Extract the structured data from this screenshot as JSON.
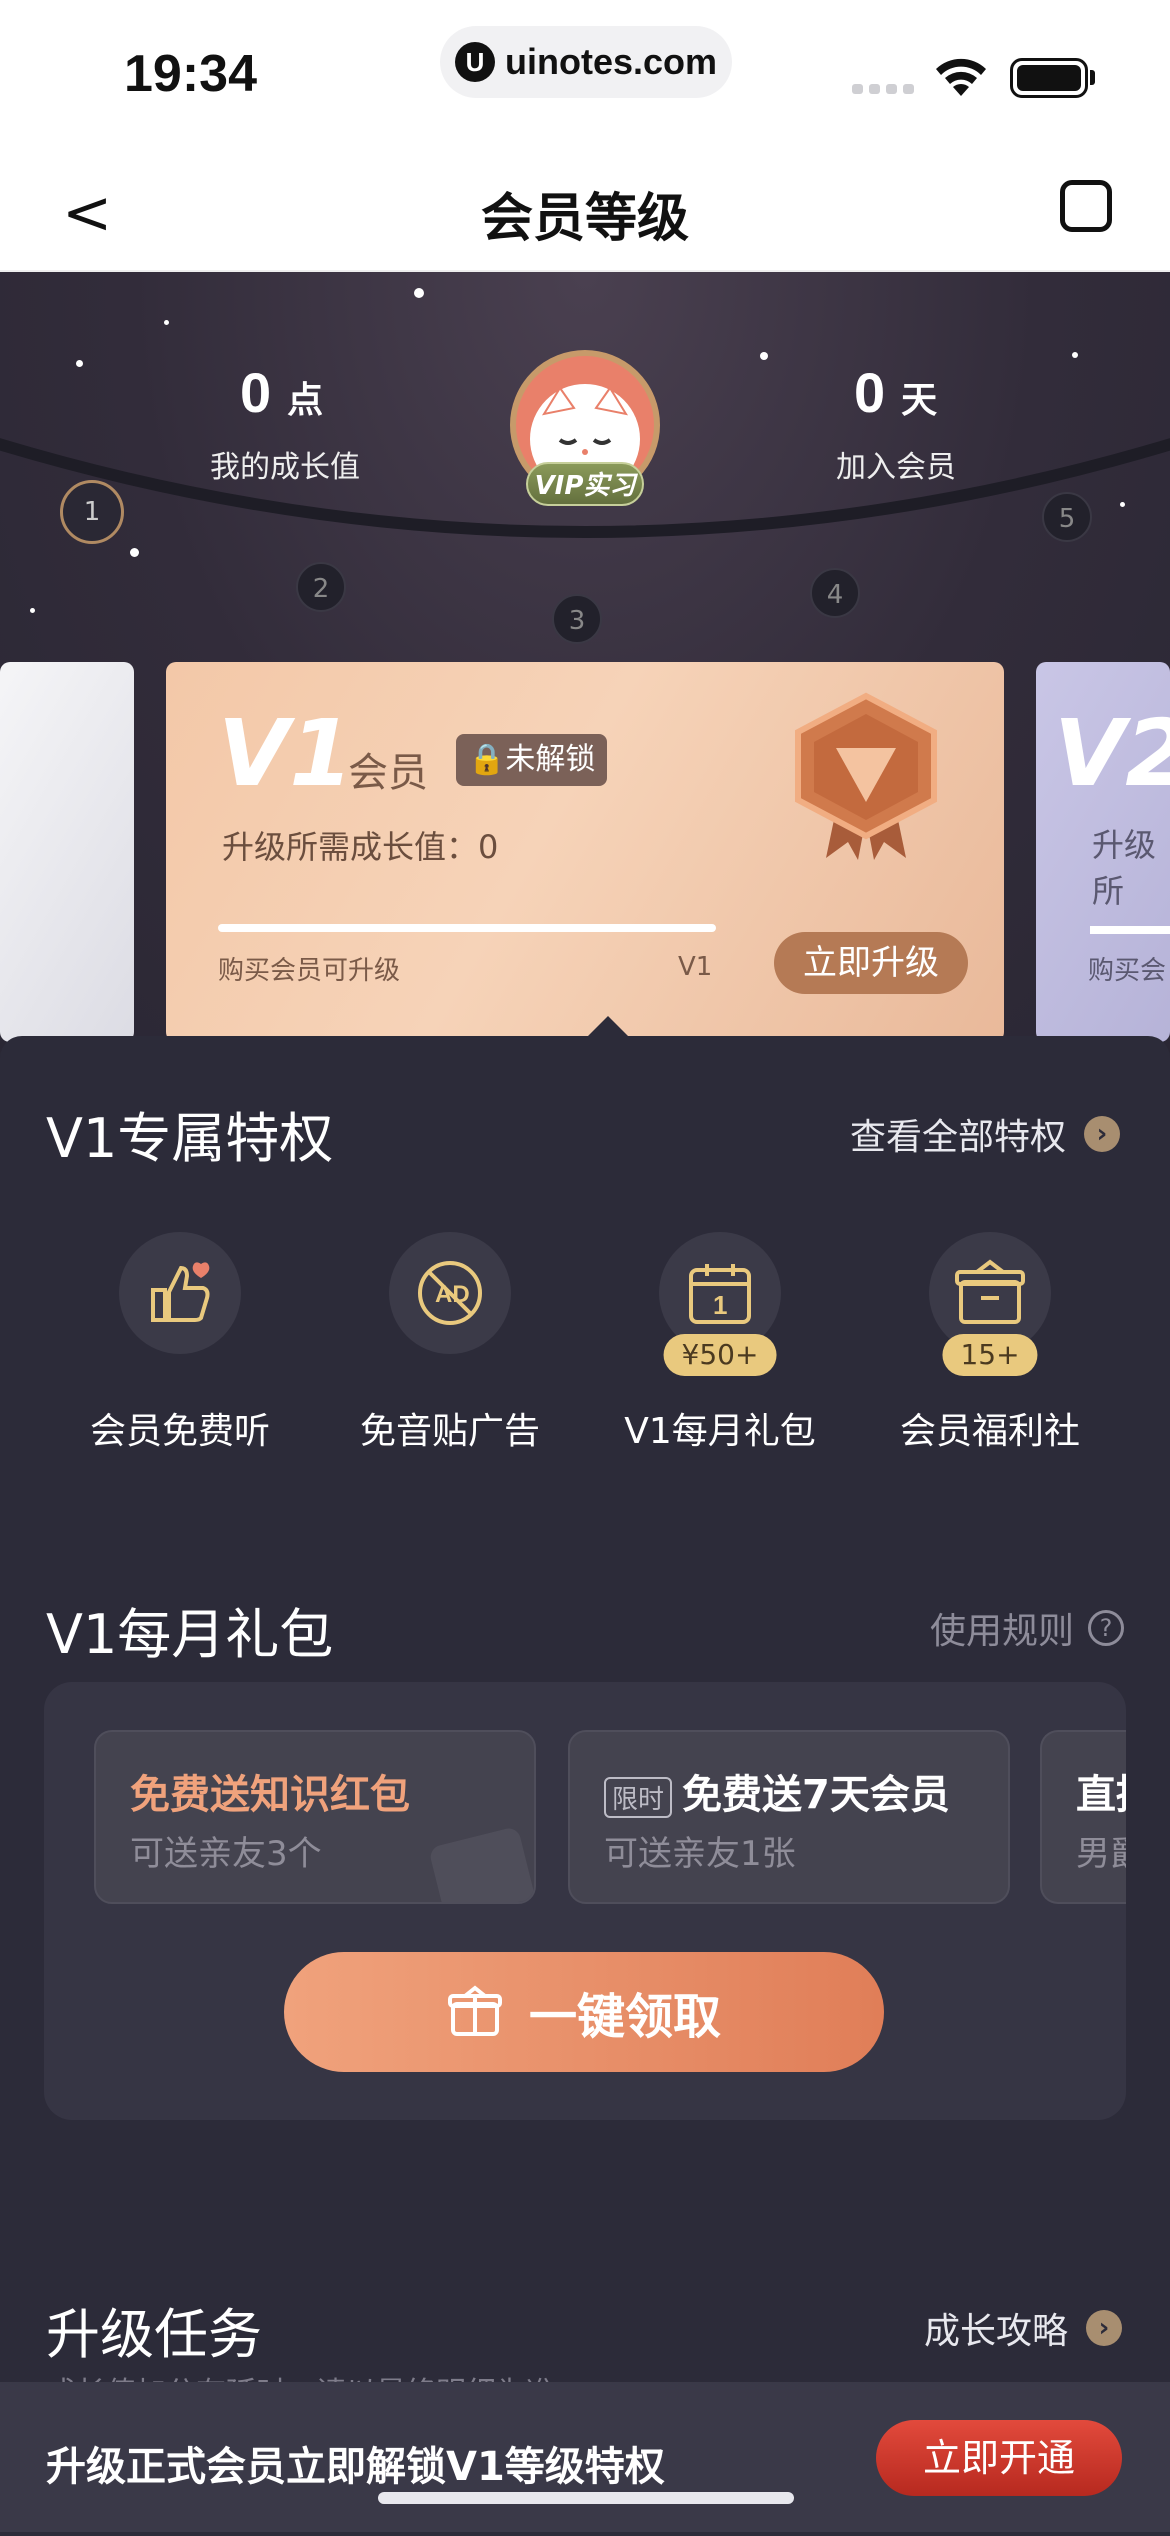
{
  "status": {
    "time": "19:34",
    "url": "uinotes.com",
    "url_icon": "U"
  },
  "nav": {
    "back": "<",
    "title": "会员等级",
    "share_icon": "share-icon"
  },
  "header": {
    "growth_value": "0",
    "growth_unit": "点",
    "growth_label": "我的成长值",
    "days_value": "0",
    "days_unit": "天",
    "days_label": "加入会员",
    "vip_tag": "VIP实习",
    "levels": [
      "1",
      "2",
      "3",
      "4",
      "5"
    ]
  },
  "card": {
    "level": "V1",
    "member": "会员",
    "locked": "未解锁",
    "requirement": "升级所需成长值：0",
    "buy_hint": "购买会员可升级",
    "level_small": "V1",
    "upgrade": "立即升级",
    "next_level": "V2",
    "next_requirement": "升级所",
    "next_buy": "购买会"
  },
  "privileges": {
    "title": "V1专属特权",
    "view_all": "查看全部特权",
    "items": [
      {
        "label": "会员免费听",
        "icon": "thumbs-up-icon"
      },
      {
        "label": "免音贴广告",
        "icon": "no-ad-icon"
      },
      {
        "label": "V1每月礼包",
        "icon": "calendar-icon",
        "badge": "¥50+"
      },
      {
        "label": "会员福利社",
        "icon": "gift-box-icon",
        "badge": "15+"
      }
    ]
  },
  "gifts": {
    "title": "V1每月礼包",
    "rules": "使用规则",
    "cards": [
      {
        "title": "免费送知识红包",
        "sub": "可送亲友3个"
      },
      {
        "tag": "限时",
        "title": "免费送7天会员",
        "sub": "可送亲友1张"
      },
      {
        "title": "直播",
        "sub": "男爵"
      }
    ],
    "claim": "一键领取"
  },
  "tasks": {
    "title": "升级任务",
    "link": "成长攻略",
    "sub": "成长值加分有延时，请以最终明细为准"
  },
  "bottom": {
    "text": "升级正式会员立即解锁V1等级特权",
    "button": "立即开通"
  },
  "colors": {
    "accent": "#e07e58",
    "panel": "#2c2b39",
    "open_button": "#d03a2e"
  }
}
